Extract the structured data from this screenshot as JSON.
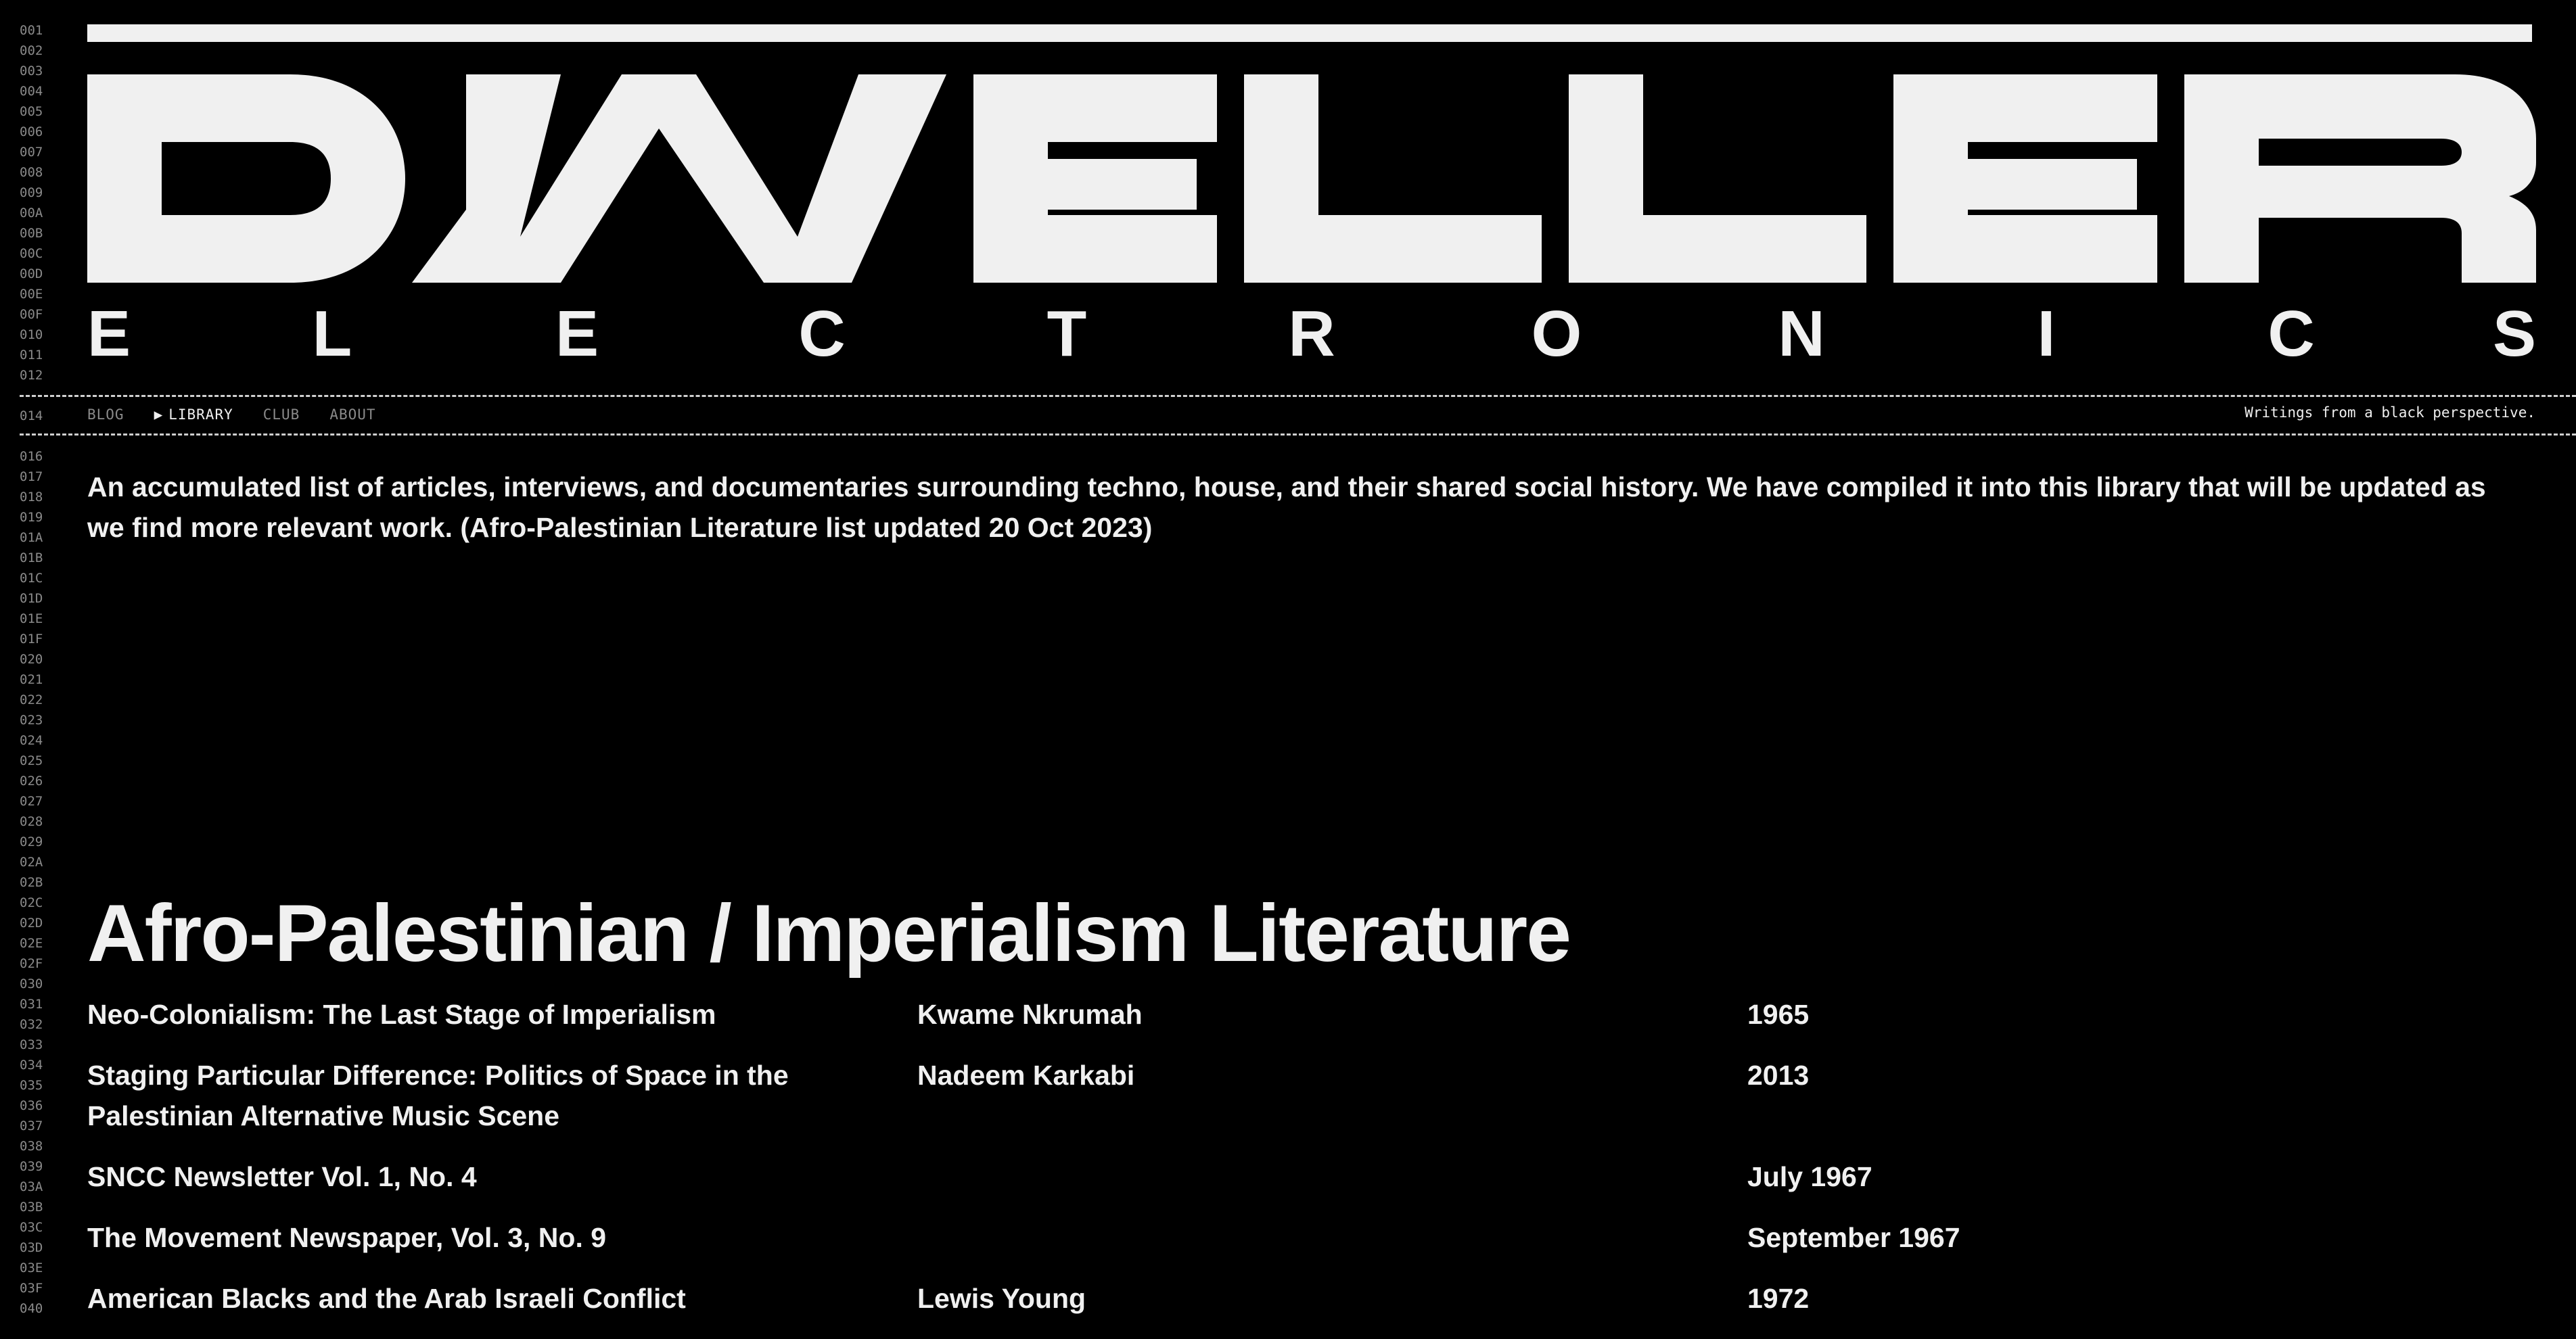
{
  "gutter": {
    "line_numbers": [
      "001",
      "002",
      "003",
      "004",
      "005",
      "006",
      "007",
      "008",
      "009",
      "00A",
      "00B",
      "00C",
      "00D",
      "00E",
      "00F",
      "010",
      "011",
      "012",
      "",
      "014",
      "",
      "016",
      "017",
      "018",
      "019",
      "01A",
      "01B",
      "01C",
      "01D",
      "01E",
      "01F",
      "020",
      "021",
      "022",
      "023",
      "024",
      "025",
      "026",
      "027",
      "028",
      "029",
      "02A",
      "02B",
      "02C",
      "02D",
      "02E",
      "02F",
      "030",
      "031",
      "032",
      "033",
      "034",
      "035",
      "036",
      "037",
      "038",
      "039",
      "03A",
      "03B",
      "03C",
      "03D",
      "03E",
      "03F",
      "040"
    ]
  },
  "logo": {
    "wordmark": "DWELLER",
    "subtitle_letters": [
      "E",
      "L",
      "E",
      "C",
      "T",
      "R",
      "O",
      "N",
      "I",
      "C",
      "S"
    ]
  },
  "nav": {
    "items": [
      {
        "label": "BLOG",
        "active": false
      },
      {
        "label": "LIBRARY",
        "active": true,
        "marker": "▶"
      },
      {
        "label": "CLUB",
        "active": false
      },
      {
        "label": "ABOUT",
        "active": false
      }
    ],
    "tagline": "Writings from a black perspective."
  },
  "intro": "An accumulated list of articles, interviews, and documentaries surrounding techno, house, and their shared social history. We have compiled it into this library that will be updated as we find more relevant work. (Afro-Palestinian Literature list updated 20 Oct 2023)",
  "section": {
    "title": "Afro-Palestinian / Imperialism Literature",
    "rows": [
      {
        "title": "Neo-Colonialism: The Last Stage of Imperialism",
        "author": "Kwame Nkrumah",
        "date": "1965"
      },
      {
        "title": "Staging Particular Difference: Politics of Space in the Palestinian Alternative Music Scene",
        "author": "Nadeem Karkabi",
        "date": "2013"
      },
      {
        "title": "SNCC Newsletter Vol. 1, No. 4",
        "author": "",
        "date": "July 1967"
      },
      {
        "title": "The Movement Newspaper, Vol. 3, No. 9",
        "author": "",
        "date": "September 1967"
      },
      {
        "title": "American Blacks and the Arab Israeli Conflict",
        "author": "Lewis Young",
        "date": "1972"
      }
    ]
  },
  "colors": {
    "background": "#000000",
    "foreground": "#f0f0f0",
    "muted": "#8a8a8a"
  }
}
